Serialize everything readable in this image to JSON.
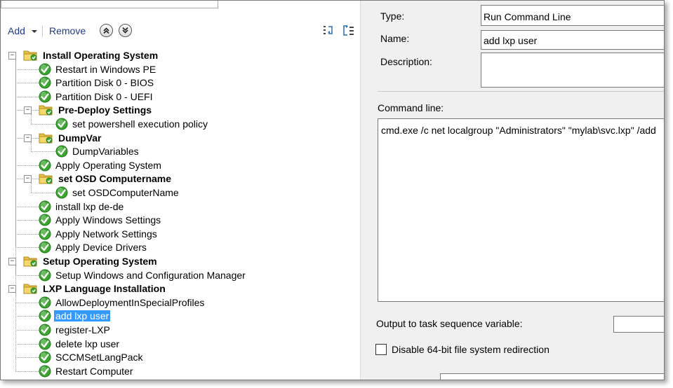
{
  "toolbar": {
    "add_label": "Add",
    "remove_label": "Remove"
  },
  "tree": {
    "rows": [
      {
        "label": "Install Operating System",
        "type": "group",
        "level": 0
      },
      {
        "label": "Restart in Windows PE",
        "type": "step",
        "level": 1
      },
      {
        "label": "Partition Disk 0 - BIOS",
        "type": "step",
        "level": 1
      },
      {
        "label": "Partition Disk 0 - UEFI",
        "type": "step",
        "level": 1
      },
      {
        "label": "Pre-Deploy Settings",
        "type": "group",
        "level": 1
      },
      {
        "label": "set powershell execution policy",
        "type": "step",
        "level": 2
      },
      {
        "label": "DumpVar",
        "type": "group",
        "level": 1
      },
      {
        "label": "DumpVariables",
        "type": "step",
        "level": 2
      },
      {
        "label": "Apply Operating System",
        "type": "step",
        "level": 1
      },
      {
        "label": "set OSD Computername",
        "type": "group",
        "level": 1
      },
      {
        "label": "set OSDComputerName",
        "type": "step",
        "level": 2
      },
      {
        "label": "install lxp de-de",
        "type": "step",
        "level": 1
      },
      {
        "label": "Apply Windows Settings",
        "type": "step",
        "level": 1
      },
      {
        "label": "Apply Network Settings",
        "type": "step",
        "level": 1
      },
      {
        "label": "Apply Device Drivers",
        "type": "step",
        "level": 1
      },
      {
        "label": "Setup Operating System",
        "type": "group",
        "level": 0
      },
      {
        "label": "Setup Windows and Configuration Manager",
        "type": "step",
        "level": 1
      },
      {
        "label": "LXP Language Installation",
        "type": "group",
        "level": 0
      },
      {
        "label": "AllowDeploymentInSpecialProfiles",
        "type": "step",
        "level": 1
      },
      {
        "label": "add lxp user",
        "type": "step",
        "level": 1,
        "selected": true
      },
      {
        "label": "register-LXP",
        "type": "step",
        "level": 1
      },
      {
        "label": "delete lxp user",
        "type": "step",
        "level": 1
      },
      {
        "label": "SCCMSetLangPack",
        "type": "step",
        "level": 1
      },
      {
        "label": "Restart Computer",
        "type": "step",
        "level": 1
      }
    ]
  },
  "properties": {
    "type_label": "Type:",
    "type_value": "Run Command Line",
    "name_label": "Name:",
    "name_value": "add lxp user",
    "description_label": "Description:",
    "description_value": "",
    "command_label": "Command line:",
    "command_value": "cmd.exe /c net localgroup \"Administrators\" \"mylab\\svc.lxp\" /add",
    "output_label": "Output to task sequence variable:",
    "output_value": "",
    "disable64_label": "Disable 64-bit file system redirection",
    "disable64_checked": false
  },
  "colors": {
    "selection": "#3399ff",
    "link": "#1e3a8a",
    "check_green": "#3aa52f",
    "folder_yellow": "#e8c34a",
    "pane_bg": "#f0f0f0"
  },
  "icons": {
    "step": "green-check-icon",
    "group": "folder-icon",
    "move_up": "chevron-up-icon",
    "move_down": "chevron-down-icon"
  }
}
